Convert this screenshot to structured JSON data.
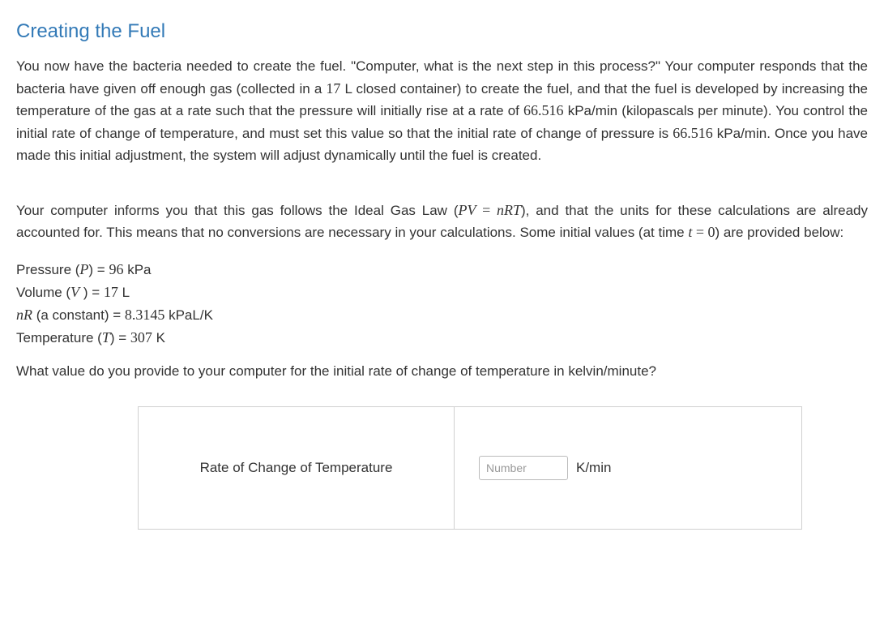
{
  "title": "Creating the Fuel",
  "paragraph1_parts": {
    "p1": "You now have the bacteria needed to create the fuel. \"Computer, what is the next step in this process?\" Your computer responds that the bacteria have given off enough gas (collected in a ",
    "volume1": "17",
    "p2": " L closed container) to create the fuel, and that the fuel is developed by increasing the temperature of the gas at a rate such that the pressure will initially rise at a rate of ",
    "rate1": "66.516",
    "p3": " kPa/min (kilopascals per minute). You control the initial rate of change of temperature, and must set this value so that the initial rate of change of pressure is ",
    "rate2": "66.516",
    "p4": " kPa/min. Once you have made this initial adjustment, the system will adjust dynamically until the fuel is created."
  },
  "paragraph2_parts": {
    "p1": "Your computer informs you that this gas follows the Ideal Gas Law (",
    "eq_lhs_P": "P",
    "eq_lhs_V": "V",
    "eq_eq": " = ",
    "eq_rhs_n": "n",
    "eq_rhs_R": "R",
    "eq_rhs_T": "T",
    "p2": "), and that the units for these calculations are already accounted for. This means that no conversions are necessary in your calculations. Some initial values (at time ",
    "tvar": "t",
    "teq": " = ",
    "tval": "0",
    "p3": ") are provided below:"
  },
  "values": {
    "pressure": {
      "label1": "Pressure (",
      "var": "P",
      "label2": ") = ",
      "val": "96",
      "unit": "  kPa"
    },
    "volume": {
      "label1": "Volume (",
      "var": "V",
      "label2": " ) = ",
      "val": "17",
      "unit": " L"
    },
    "nR": {
      "var_n": "n",
      "var_R": "R",
      "label2": " (a constant) = ",
      "val": "8.3145",
      "unit": "  kPaL/K"
    },
    "temperature": {
      "label1": "Temperature (",
      "var": "T",
      "label2": ") = ",
      "val": "307",
      "unit": " K"
    }
  },
  "question": "What value do you provide to your computer for the initial rate of change of temperature in kelvin/minute?",
  "answer": {
    "label": "Rate of Change of Temperature",
    "placeholder": "Number",
    "unit": "K/min"
  }
}
